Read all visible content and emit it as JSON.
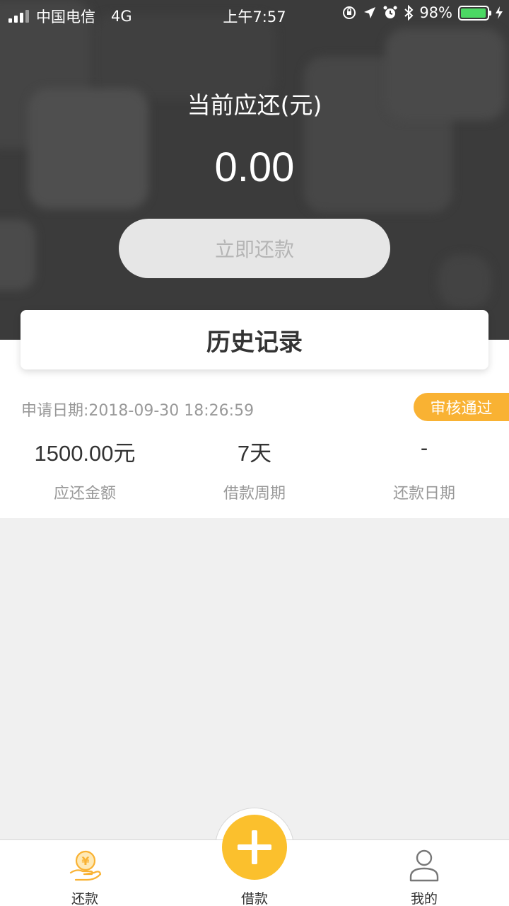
{
  "status_bar": {
    "carrier": "中国电信",
    "network": "4G",
    "time": "上午7:57",
    "battery": "98%",
    "battery_color": "#4cd964"
  },
  "header": {
    "title": "当前应还(元)",
    "amount": "0.00",
    "repay_button": "立即还款"
  },
  "history": {
    "title": "历史记录"
  },
  "record": {
    "apply_date": "申请日期:2018-09-30 18:26:59",
    "status": "审核通过",
    "status_color": "#f9b233",
    "columns": [
      {
        "value": "1500.00元",
        "label": "应还金额"
      },
      {
        "value": "7天",
        "label": "借款周期"
      },
      {
        "value": "-",
        "label": "还款日期"
      }
    ]
  },
  "tabbar": {
    "tabs": [
      {
        "label": "还款",
        "icon": "hand-yen-icon"
      },
      {
        "label": "借款",
        "icon": "plus-icon"
      },
      {
        "label": "我的",
        "icon": "user-icon"
      }
    ],
    "accent_color": "#fbc02d"
  }
}
